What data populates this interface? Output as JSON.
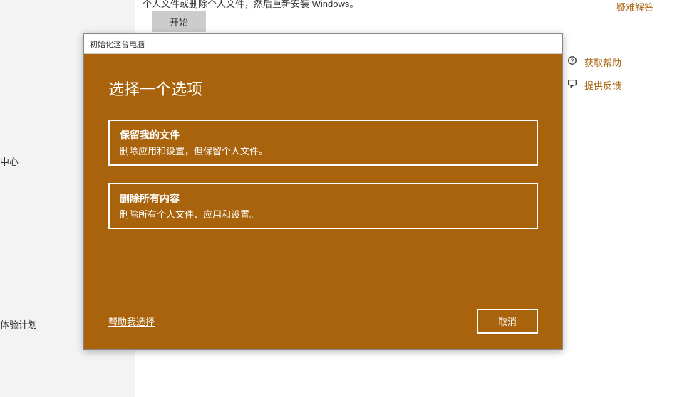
{
  "background": {
    "top_text_fragment": "个人文件或删除个人文件，然后重新安装 Windows。",
    "start_button": "开始",
    "left_label_1": "中心",
    "left_label_2": "体验计划"
  },
  "side_links": {
    "troubleshoot": "疑难解答",
    "get_help": "获取帮助",
    "give_feedback": "提供反馈"
  },
  "dialog": {
    "window_title": "初始化这台电脑",
    "heading": "选择一个选项",
    "options": [
      {
        "title": "保留我的文件",
        "desc": "删除应用和设置，但保留个人文件。"
      },
      {
        "title": "删除所有内容",
        "desc": "删除所有个人文件、应用和设置。"
      }
    ],
    "help_link": "帮助我选择",
    "cancel": "取消"
  }
}
